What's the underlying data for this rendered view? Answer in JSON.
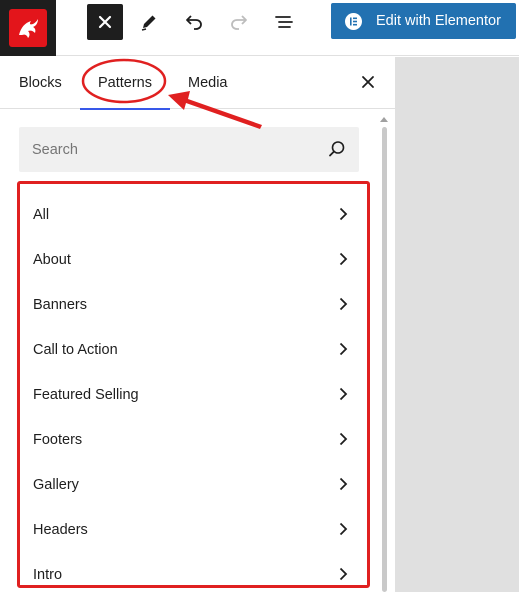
{
  "toolbar": {
    "close_icon": "close-icon",
    "edit_icon": "pen-icon",
    "undo_icon": "undo-icon",
    "redo_icon": "redo-icon",
    "outline_icon": "list-view-icon",
    "elementor_label": "Edit with Elementor",
    "elementor_color": "#2271b1"
  },
  "logo": {
    "icon": "dragon-logo-icon",
    "color": "#e3151b"
  },
  "inserter": {
    "tabs": [
      {
        "label": "Blocks",
        "active": false
      },
      {
        "label": "Patterns",
        "active": true
      },
      {
        "label": "Media",
        "active": false
      }
    ],
    "close_icon": "close-icon",
    "search": {
      "placeholder": "Search",
      "value": "",
      "icon": "search-icon"
    },
    "categories": [
      {
        "label": "All"
      },
      {
        "label": "About"
      },
      {
        "label": "Banners"
      },
      {
        "label": "Call to Action"
      },
      {
        "label": "Featured Selling"
      },
      {
        "label": "Footers"
      },
      {
        "label": "Gallery"
      },
      {
        "label": "Headers"
      },
      {
        "label": "Intro"
      }
    ]
  },
  "annotation": {
    "color": "#e02020",
    "active_tab_color": "#3858e9"
  }
}
